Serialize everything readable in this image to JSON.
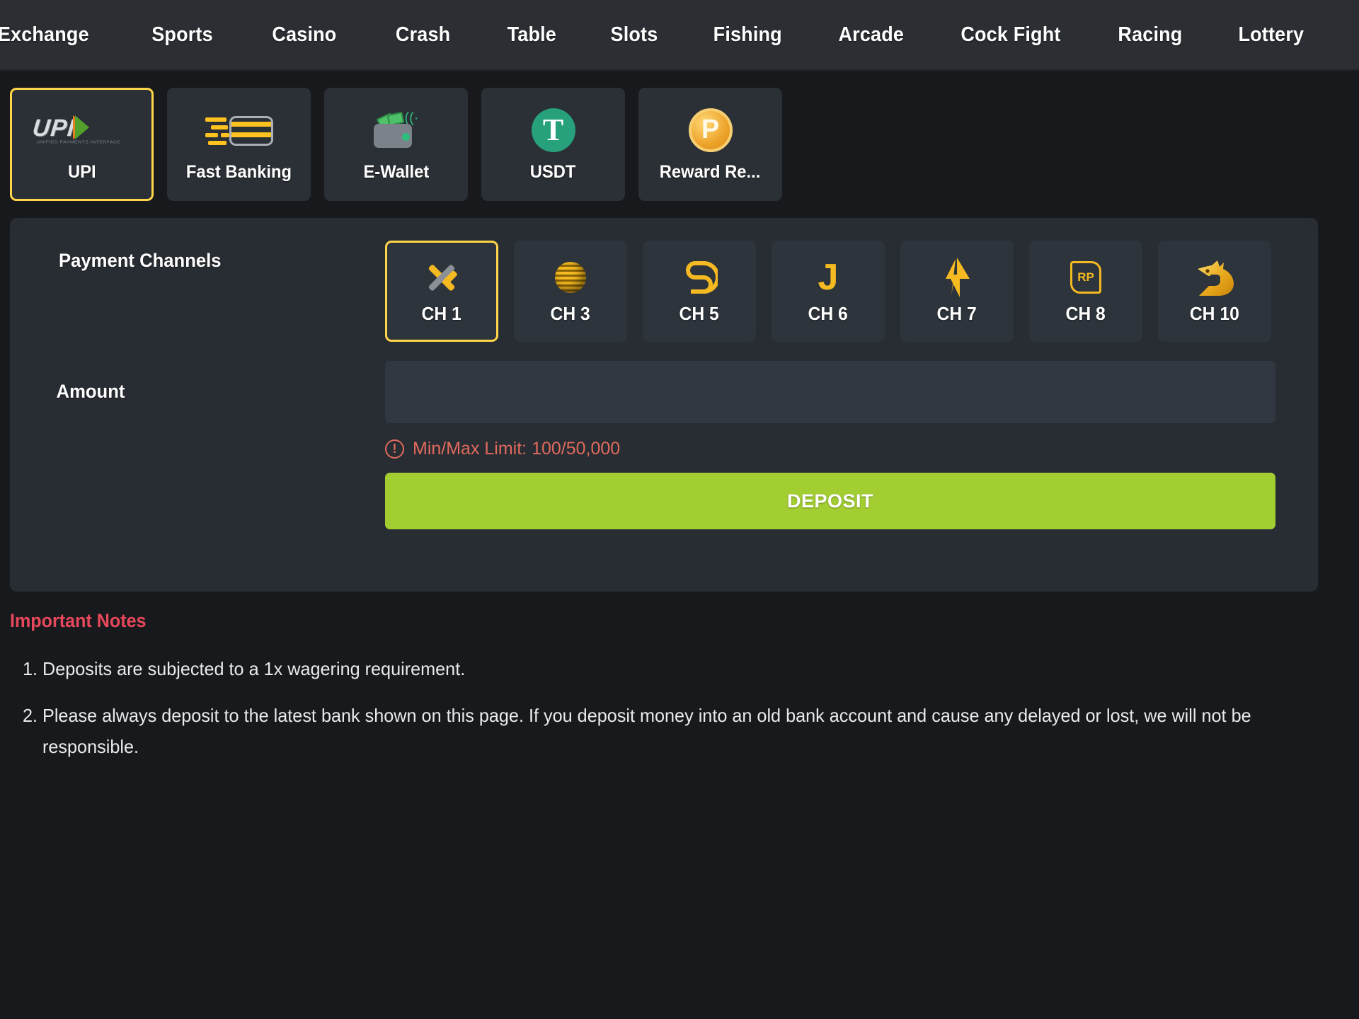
{
  "nav": {
    "items": [
      {
        "label": "Exchange"
      },
      {
        "label": "Sports"
      },
      {
        "label": "Casino"
      },
      {
        "label": "Crash"
      },
      {
        "label": "Table"
      },
      {
        "label": "Slots"
      },
      {
        "label": "Fishing"
      },
      {
        "label": "Arcade"
      },
      {
        "label": "Cock Fight"
      },
      {
        "label": "Racing"
      },
      {
        "label": "Lottery"
      }
    ]
  },
  "payment_methods": {
    "selected": "UPI",
    "items": [
      {
        "label": "UPI",
        "icon": "upi-logo-icon",
        "selected": true
      },
      {
        "label": "Fast Banking",
        "icon": "bank-card-icon",
        "selected": false
      },
      {
        "label": "E-Wallet",
        "icon": "wallet-icon",
        "selected": false
      },
      {
        "label": "USDT",
        "icon": "tether-icon",
        "selected": false
      },
      {
        "label": "Reward Re...",
        "icon": "reward-coin-icon",
        "selected": false
      }
    ],
    "upi_logo_text": "UPI",
    "upi_logo_subtext": "UNIFIED PAYMENTS INTERFACE",
    "usdt_symbol": "T",
    "reward_symbol": "P"
  },
  "form": {
    "channels_label": "Payment Channels",
    "amount_label": "Amount",
    "amount_value": "",
    "amount_placeholder": "",
    "limit_text": "Min/Max Limit: 100/50,000",
    "limit_icon": "warning-exclamation-icon",
    "deposit_label": "DEPOSIT",
    "channels": [
      {
        "label": "CH 1",
        "icon": "cross-x-icon",
        "glyph": "",
        "selected": true
      },
      {
        "label": "CH 3",
        "icon": "striped-sphere-icon",
        "glyph": "",
        "selected": false
      },
      {
        "label": "CH 5",
        "icon": "sd-monogram-icon",
        "glyph": "ᔐ",
        "selected": false
      },
      {
        "label": "CH 6",
        "icon": "letter-j-icon",
        "glyph": "J",
        "selected": false
      },
      {
        "label": "CH 7",
        "icon": "lightning-bolt-icon",
        "glyph": "⚡",
        "selected": false
      },
      {
        "label": "CH 8",
        "icon": "rp-badge-icon",
        "glyph": "RP",
        "selected": false
      },
      {
        "label": "CH 10",
        "icon": "dragon-head-icon",
        "glyph": "🐉",
        "selected": false
      }
    ]
  },
  "notes": {
    "title": "Important Notes",
    "items": [
      "Deposits are subjected to a 1x wagering requirement.",
      "Please always deposit to the latest bank shown on this page. If you deposit money into an old bank account and cause any delayed or lost, we will not be responsible."
    ]
  },
  "colors": {
    "accent_yellow": "#ffd54a",
    "gold": "#f5b921",
    "deposit_green": "#a3ce32",
    "usdt_green": "#26a17b",
    "warning_red": "#e06a5c",
    "notes_red": "#e8485b",
    "panel_bg": "#282d33",
    "page_bg": "#17191c",
    "nav_bg": "#2b2f33"
  }
}
